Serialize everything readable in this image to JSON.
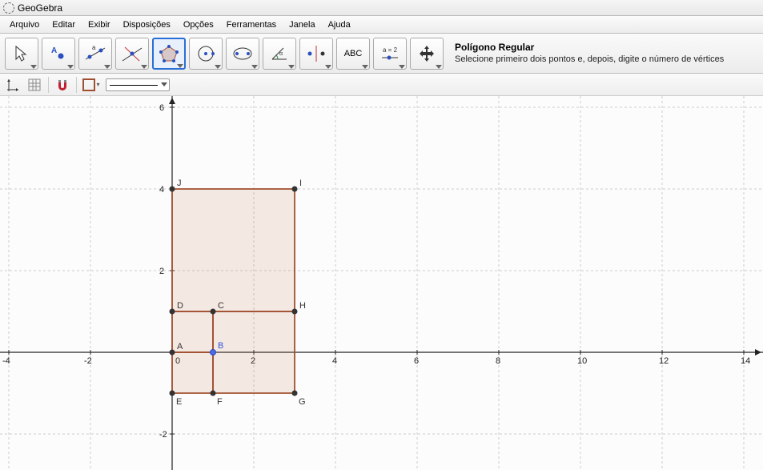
{
  "app": {
    "title": "GeoGebra"
  },
  "menu": {
    "items": [
      "Arquivo",
      "Editar",
      "Exibir",
      "Disposições",
      "Opções",
      "Ferramentas",
      "Janela",
      "Ajuda"
    ]
  },
  "toolbar": {
    "tools": [
      {
        "name": "move-tool"
      },
      {
        "name": "point-tool"
      },
      {
        "name": "line-tool"
      },
      {
        "name": "perpendicular-tool"
      },
      {
        "name": "polygon-tool",
        "selected": true
      },
      {
        "name": "circle-tool"
      },
      {
        "name": "conic-tool"
      },
      {
        "name": "angle-tool"
      },
      {
        "name": "reflect-tool"
      },
      {
        "name": "text-tool",
        "label": "ABC"
      },
      {
        "name": "slider-tool",
        "label": "a = 2"
      },
      {
        "name": "move-view-tool"
      }
    ],
    "hint": {
      "title": "Polígono Regular",
      "desc": "Selecione primeiro dois pontos e, depois, digite o número de vértices"
    }
  },
  "stylebar": {
    "axes": true,
    "grid": true,
    "snap": true,
    "colorbox": "#a05030"
  },
  "chart_data": {
    "type": "geometry",
    "title": "",
    "xlabel": "",
    "ylabel": "",
    "xlim": [
      -5,
      15
    ],
    "ylim": [
      -3,
      6.5
    ],
    "xticks": [
      -4,
      -2,
      0,
      2,
      4,
      6,
      8,
      10,
      12,
      14
    ],
    "yticks": [
      -2,
      0,
      2,
      4,
      6
    ],
    "grid": true,
    "polygons": [
      {
        "vertices": [
          "D",
          "J",
          "I",
          "H"
        ],
        "coords": [
          [
            0,
            1
          ],
          [
            0,
            4
          ],
          [
            3,
            4
          ],
          [
            3,
            1
          ]
        ]
      },
      {
        "vertices": [
          "A",
          "D",
          "C",
          "B"
        ],
        "coords": [
          [
            0,
            0
          ],
          [
            0,
            1
          ],
          [
            1,
            1
          ],
          [
            1,
            0
          ]
        ]
      },
      {
        "vertices": [
          "B",
          "C",
          "H",
          "G",
          "F"
        ],
        "coords": [
          [
            1,
            0
          ],
          [
            1,
            1
          ],
          [
            3,
            1
          ],
          [
            3,
            -1
          ],
          [
            1,
            -1
          ]
        ]
      },
      {
        "vertices": [
          "A",
          "B",
          "F",
          "E"
        ],
        "coords": [
          [
            0,
            0
          ],
          [
            1,
            0
          ],
          [
            1,
            -1
          ],
          [
            0,
            -1
          ]
        ]
      }
    ],
    "points": [
      {
        "label": "A",
        "x": 0,
        "y": 0
      },
      {
        "label": "B",
        "x": 1,
        "y": 0,
        "color": "blue"
      },
      {
        "label": "C",
        "x": 1,
        "y": 1
      },
      {
        "label": "D",
        "x": 0,
        "y": 1
      },
      {
        "label": "E",
        "x": 0,
        "y": -1
      },
      {
        "label": "F",
        "x": 1,
        "y": -1
      },
      {
        "label": "G",
        "x": 3,
        "y": -1
      },
      {
        "label": "H",
        "x": 3,
        "y": 1
      },
      {
        "label": "I",
        "x": 3,
        "y": 4
      },
      {
        "label": "J",
        "x": 0,
        "y": 4
      }
    ]
  }
}
